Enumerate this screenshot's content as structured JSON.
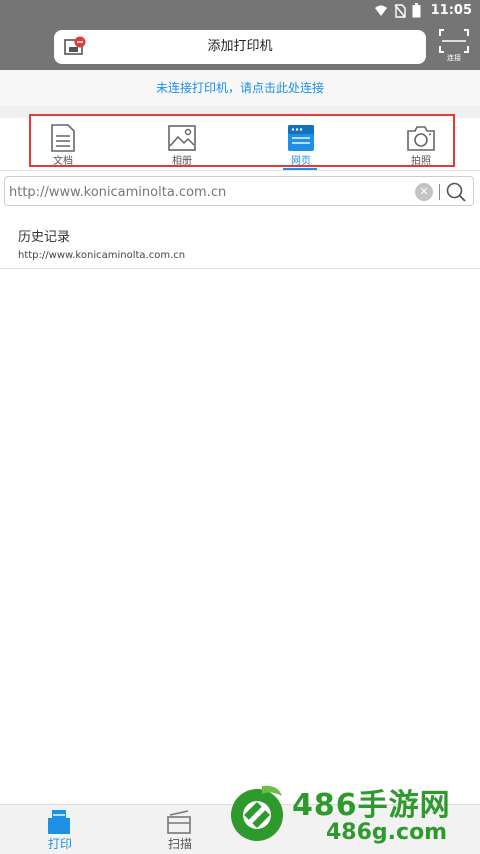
{
  "status_bar": {
    "time": "11:05"
  },
  "header": {
    "title": "添加打印机",
    "scan_label": "连接"
  },
  "banner": {
    "text": "未连接打印机，请点击此处连接"
  },
  "tabs": [
    {
      "label": "文档",
      "icon": "document-icon",
      "active": false
    },
    {
      "label": "相册",
      "icon": "photo-icon",
      "active": false
    },
    {
      "label": "网页",
      "icon": "webpage-icon",
      "active": true
    },
    {
      "label": "拍照",
      "icon": "camera-icon",
      "active": false
    }
  ],
  "url_bar": {
    "value": "http://www.konicaminolta.com.cn"
  },
  "history": {
    "title": "历史记录",
    "items": [
      "http://www.konicaminolta.com.cn"
    ]
  },
  "bottom_nav": [
    {
      "label": "打印",
      "icon": "print-icon",
      "active": true
    },
    {
      "label": "扫描",
      "icon": "scan-icon",
      "active": false
    }
  ],
  "watermark": {
    "title": "486手游网",
    "subtitle": "486g.com"
  },
  "colors": {
    "accent": "#1e90e6",
    "header_bg": "#757575",
    "highlight_border": "#e53935",
    "watermark": "#2e9a2c"
  }
}
